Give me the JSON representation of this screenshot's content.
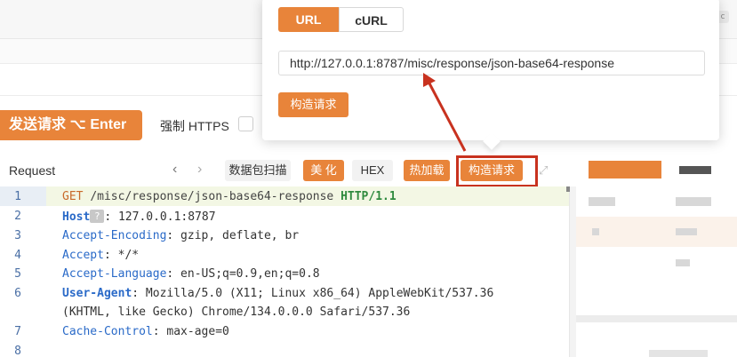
{
  "corner_badge": "c",
  "toolbar": {
    "send_label": "发送请求 ⌥ Enter",
    "force_https_label": "强制 HTTPS"
  },
  "request_panel": {
    "title": "Request",
    "nav_prev": "‹",
    "nav_next": "›",
    "buttons": {
      "capture": "数据包扫描",
      "beautify": "美 化",
      "hex": "HEX",
      "hotload": "热加载",
      "build_request": "构造请求"
    }
  },
  "editor": {
    "line_numbers": [
      "1",
      "2",
      "3",
      "4",
      "5",
      "6",
      "",
      "7",
      "8"
    ],
    "lines": [
      {
        "method": "GET",
        "path": "/misc/response/json-base64-response",
        "proto": "HTTP/1.1"
      },
      {
        "name": "Host",
        "badge": "?",
        "value": ": 127.0.0.1:8787"
      },
      {
        "name": "Accept-Encoding",
        "value": ": gzip, deflate, br"
      },
      {
        "name": "Accept",
        "value": ": */*"
      },
      {
        "name": "Accept-Language",
        "value": ": en-US;q=0.9,en;q=0.8"
      },
      {
        "name": "User-Agent",
        "value": ": Mozilla/5.0 (X11; Linux x86_64) AppleWebKit/537.36"
      },
      {
        "continuation": "(KHTML, like Gecko) Chrome/134.0.0.0 Safari/537.36"
      },
      {
        "name": "Cache-Control",
        "value": ": max-age=0"
      }
    ]
  },
  "popover": {
    "tabs": [
      "URL",
      "cURL"
    ],
    "active_tab": "URL",
    "url_value": "http://127.0.0.1:8787/misc/response/json-base64-response",
    "build_button": "构造请求"
  },
  "colors": {
    "accent": "#e8843a",
    "annotation": "#c8321f"
  }
}
